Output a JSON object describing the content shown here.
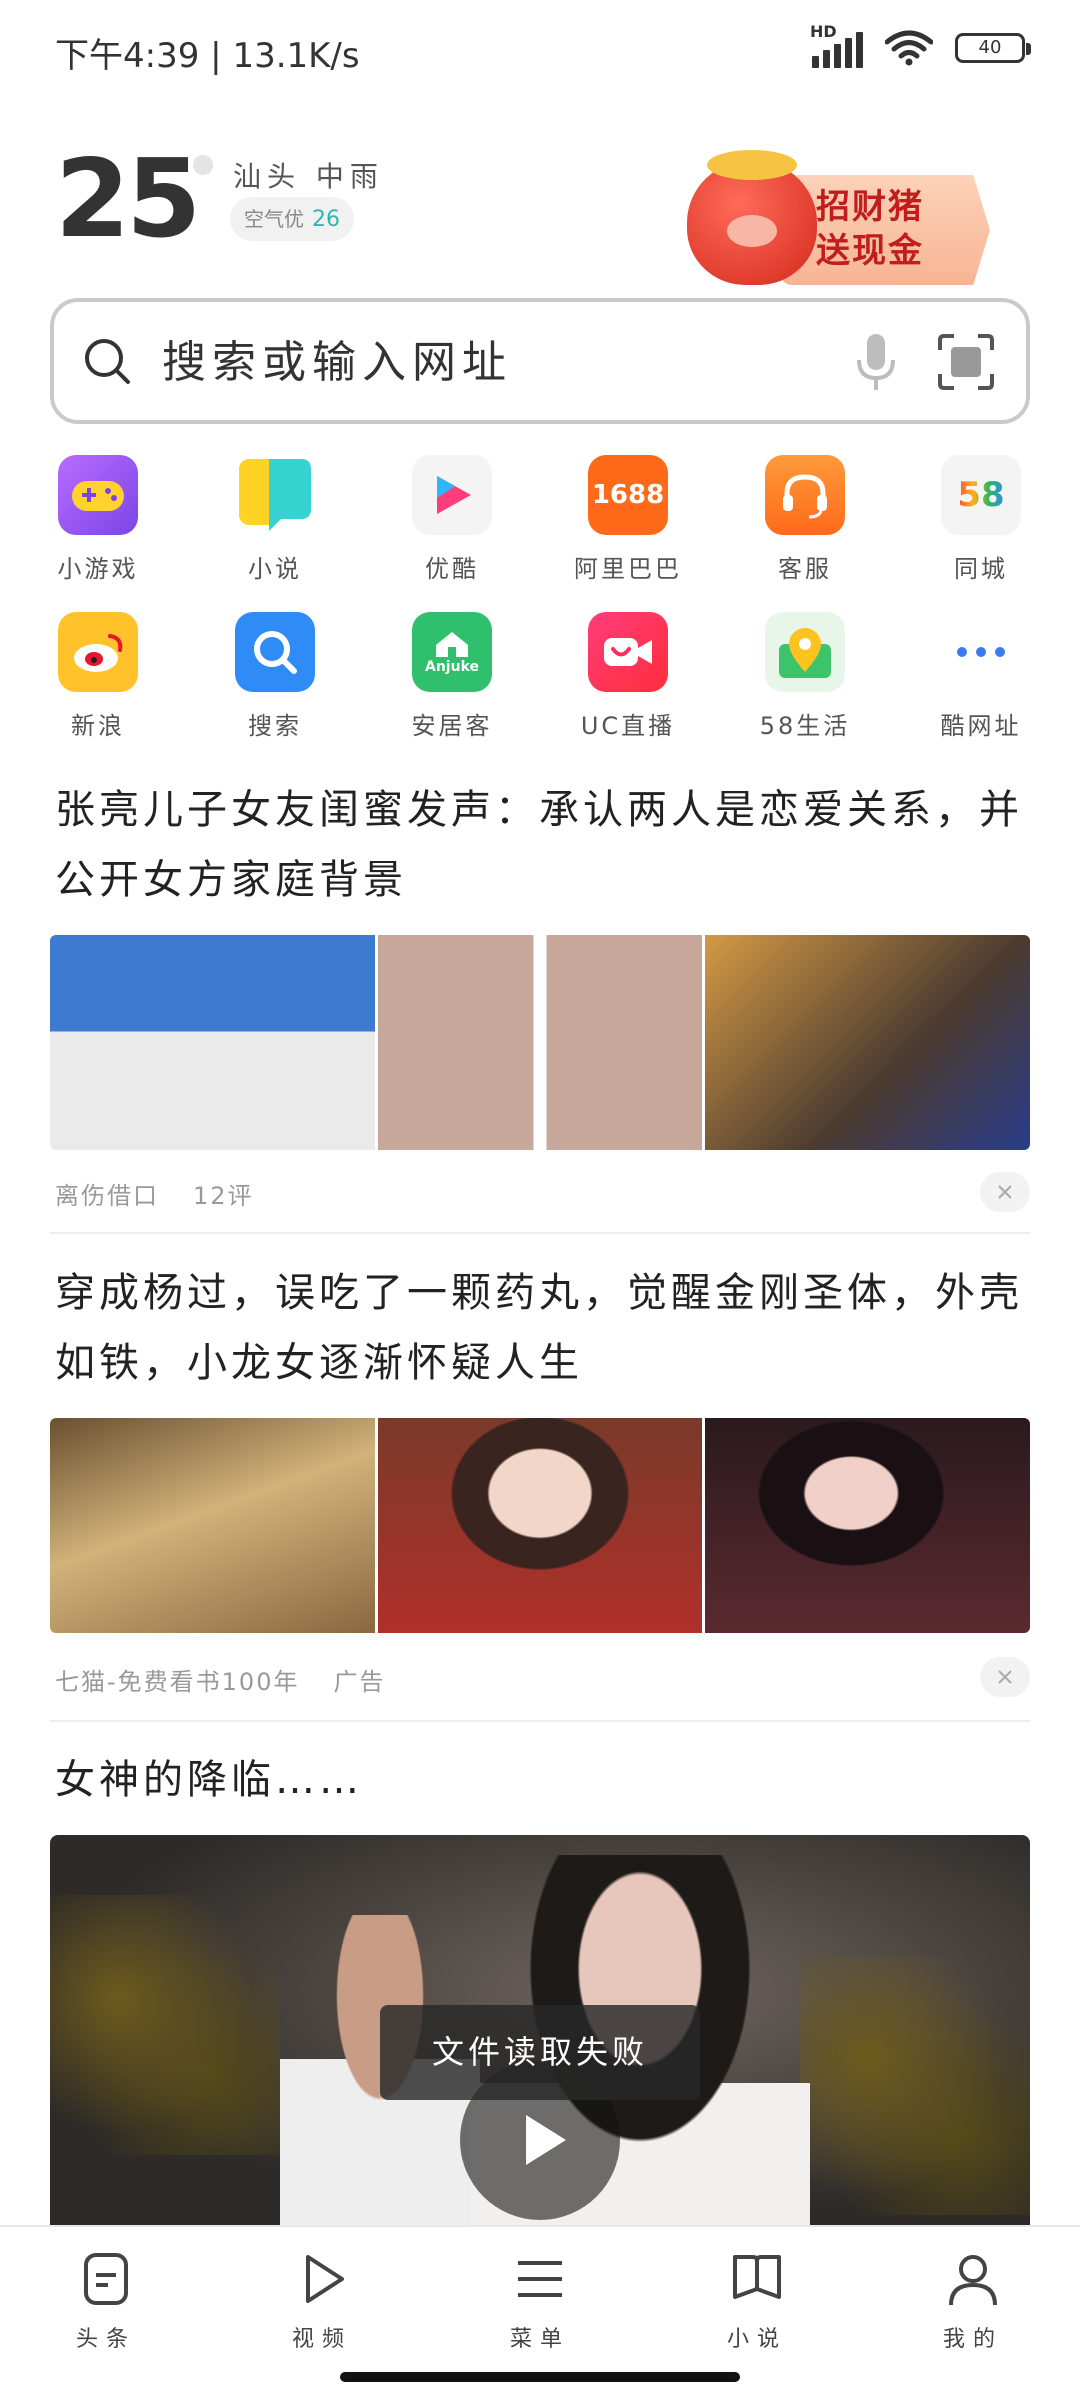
{
  "status_bar": {
    "time": "下午4:39",
    "speed": "13.1K/s",
    "network": "HD",
    "battery": "40"
  },
  "weather": {
    "temperature": "25",
    "city": "汕头",
    "condition": "中雨",
    "air_label": "空气优",
    "air_value": "26"
  },
  "promo": {
    "line1": "招财猪",
    "line2": "送现金"
  },
  "search": {
    "placeholder": "搜索或输入网址"
  },
  "shortcuts": [
    {
      "label": "小游戏",
      "icon": "game-icon",
      "color": "#9a5cf0"
    },
    {
      "label": "小说",
      "icon": "novel-icon",
      "color": "#ffd226"
    },
    {
      "label": "优酷",
      "icon": "youku-icon",
      "color": "#f4f4f4"
    },
    {
      "label": "阿里巴巴",
      "icon": "alibaba-1688-icon",
      "color": "#ff6a1a",
      "text": "1688"
    },
    {
      "label": "客服",
      "icon": "headset-icon",
      "color": "#ff7a2a"
    },
    {
      "label": "同城",
      "icon": "58-tongcheng-icon",
      "color": "#f4f4f4",
      "text": "58"
    },
    {
      "label": "新浪",
      "icon": "sina-weibo-icon",
      "color": "#ffc22b"
    },
    {
      "label": "搜索",
      "icon": "search-app-icon",
      "color": "#2f8cf7"
    },
    {
      "label": "安居客",
      "icon": "anjuke-icon",
      "color": "#2fbf6d",
      "text": "Anjuke"
    },
    {
      "label": "UC直播",
      "icon": "uc-live-icon",
      "color": "#ff2d5a"
    },
    {
      "label": "58生活",
      "icon": "map-pin-icon",
      "color": "#e8f6ea"
    },
    {
      "label": "酷网址",
      "icon": "more-dots-icon",
      "color": "#ffffff"
    }
  ],
  "feed": [
    {
      "title": "张亮儿子女友闺蜜发声：承认两人是恋爱关系，并公开女方家庭背景",
      "source": "离伤借口",
      "comments": "12评",
      "images": [
        "#7fa6d6",
        "#d9c7bd",
        "#c99c5a"
      ]
    },
    {
      "title": "穿成杨过，误吃了一颗药丸，觉醒金刚圣体，外壳如铁，小龙女逐渐怀疑人生",
      "source": "七猫-免费看书100年",
      "tag": "广告",
      "images": [
        "#b08a56",
        "#a8322c",
        "#3a2a2e"
      ]
    },
    {
      "title": "女神的降临……",
      "video_error": "文件读取失败"
    }
  ],
  "bottom_nav": [
    {
      "label": "头条",
      "icon": "headline-icon"
    },
    {
      "label": "视频",
      "icon": "video-play-icon"
    },
    {
      "label": "菜单",
      "icon": "menu-icon"
    },
    {
      "label": "小说",
      "icon": "book-icon"
    },
    {
      "label": "我的",
      "icon": "user-icon"
    }
  ]
}
